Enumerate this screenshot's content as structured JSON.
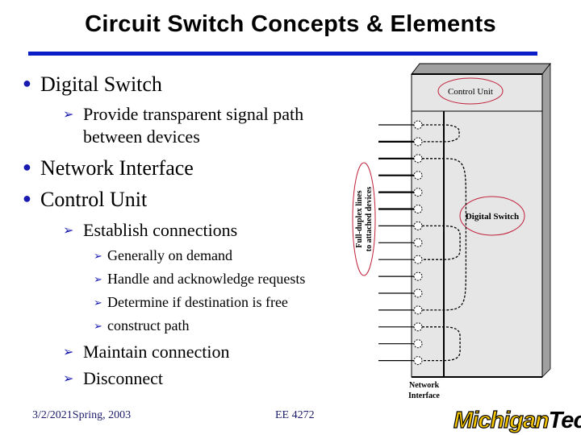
{
  "slide": {
    "title": "Circuit Switch Concepts & Elements",
    "accent_color": "#0a1ec8",
    "bullet_color": "#1a1ab0"
  },
  "bullets": [
    {
      "text": "Digital Switch",
      "sub": [
        {
          "line1": "Provide transparent signal path",
          "line2": "between devices"
        }
      ]
    },
    {
      "text": "Network Interface"
    },
    {
      "text": "Control Unit"
    }
  ],
  "control_unit_items": {
    "establish": "Establish connections",
    "establish_sub": [
      "Generally on demand",
      "Handle and acknowledge requests",
      "Determine if destination is free",
      "construct path"
    ],
    "maintain": "Maintain connection",
    "disconnect": "Disconnect"
  },
  "diagram": {
    "control_unit_label": "Control Unit",
    "digital_switch_label": "Digital Switch",
    "lines_label_1": "Full-duplex lines",
    "lines_label_2": "to attached devices",
    "network_interface_label_1": "Network",
    "network_interface_label_2": "Interface",
    "port_count": 15,
    "connections": [
      [
        1,
        2
      ],
      [
        3,
        12
      ],
      [
        7,
        9
      ],
      [
        13,
        15
      ]
    ],
    "highlight_color": "#c0203a",
    "box_fill": "#e6e6e6",
    "shade_fill": "#a0a0a0"
  },
  "footer": {
    "date_term": "3/2/2021Spring, 2003",
    "course": "EE 4272",
    "logo_part1": "Michigan",
    "logo_part2": "Tech"
  }
}
